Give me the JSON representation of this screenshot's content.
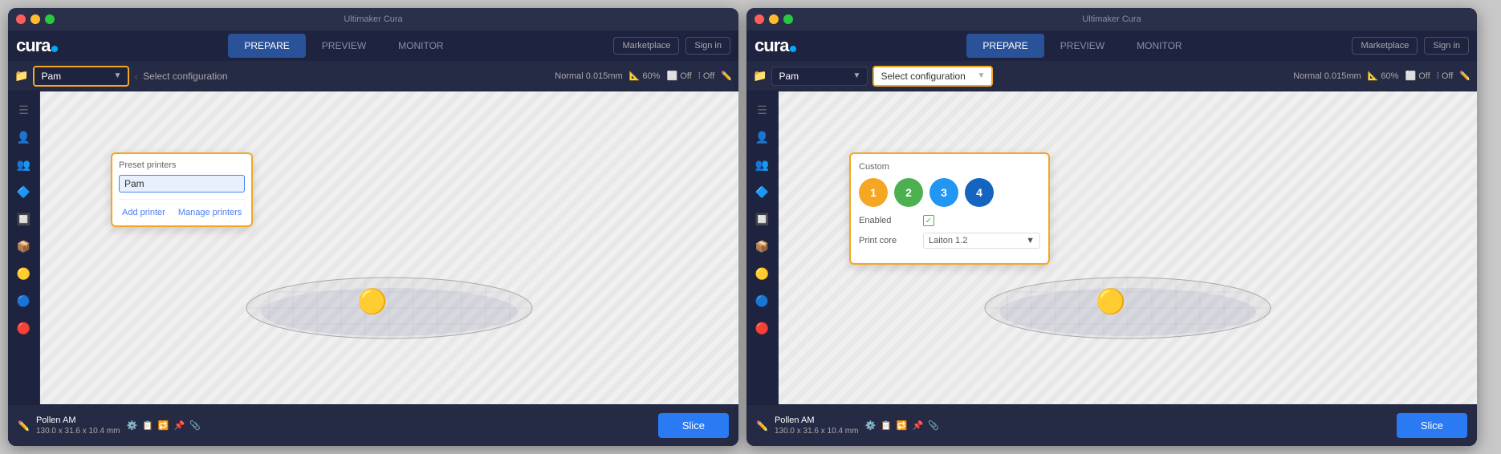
{
  "app": {
    "title": "Ultimaker Cura"
  },
  "window_left": {
    "title": "Ultimaker Cura",
    "nav": {
      "prepare_label": "PREPARE",
      "preview_label": "PREVIEW",
      "monitor_label": "MONITOR",
      "marketplace_label": "Marketplace",
      "signin_label": "Sign in"
    },
    "toolbar": {
      "printer_name": "Pam",
      "config_label": "Select configuration",
      "profile_label": "Normal 0.015mm",
      "scale_label": "60%",
      "support_label": "Off",
      "adhesion_label": "Off"
    },
    "dropdown": {
      "section_title": "Preset printers",
      "selected_printer": "Pam",
      "add_btn": "Add printer",
      "manage_btn": "Manage printers"
    },
    "model": {
      "name": "Pollen AM",
      "dimensions": "130.0 x 31.6 x 10.4 mm"
    },
    "slice_btn": "Slice"
  },
  "window_right": {
    "title": "Ultimaker Cura",
    "nav": {
      "prepare_label": "PREPARE",
      "preview_label": "PREVIEW",
      "monitor_label": "MONITOR",
      "marketplace_label": "Marketplace",
      "signin_label": "Sign in"
    },
    "toolbar": {
      "printer_name": "Pam",
      "config_label": "Select configuration",
      "profile_label": "Normal 0.015mm",
      "scale_label": "60%",
      "support_label": "Off",
      "adhesion_label": "Off"
    },
    "config_popup": {
      "section_title": "Custom",
      "extruders": [
        {
          "label": "1",
          "color": "yellow"
        },
        {
          "label": "2",
          "color": "green"
        },
        {
          "label": "3",
          "color": "blue"
        },
        {
          "label": "4",
          "color": "darkblue"
        }
      ],
      "enabled_label": "Enabled",
      "enabled_checked": true,
      "print_core_label": "Print core",
      "print_core_value": "Laiton 1.2"
    },
    "model": {
      "name": "Pollen AM",
      "dimensions": "130.0 x 31.6 x 10.4 mm"
    },
    "slice_btn": "Slice"
  }
}
